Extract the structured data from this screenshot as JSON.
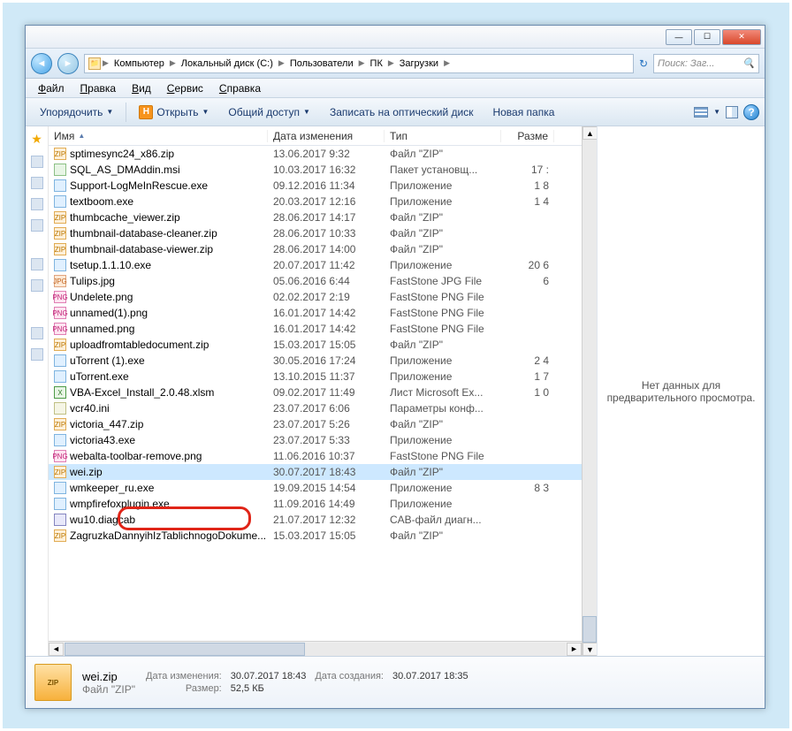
{
  "window_controls": {
    "minimize": "—",
    "maximize": "☐",
    "close": "✕"
  },
  "nav": {
    "back": "◄",
    "forward": "►"
  },
  "breadcrumbs": [
    "Компьютер",
    "Локальный диск (C:)",
    "Пользователи",
    "ПК",
    "Загрузки"
  ],
  "search": {
    "placeholder": "Поиск: Заг..."
  },
  "menus": [
    {
      "label": "Файл",
      "u": "Ф"
    },
    {
      "label": "Правка",
      "u": "П"
    },
    {
      "label": "Вид",
      "u": "В"
    },
    {
      "label": "Сервис",
      "u": "С"
    },
    {
      "label": "Справка",
      "u": "С"
    }
  ],
  "toolbar": {
    "organize": "Упорядочить",
    "open": "Открыть",
    "open_hotkey": "H",
    "share": "Общий доступ",
    "burn": "Записать на оптический диск",
    "newfolder": "Новая папка"
  },
  "columns": {
    "name": "Имя",
    "date": "Дата изменения",
    "type": "Тип",
    "size": "Разме"
  },
  "preview_empty": "Нет данных для предварительного просмотра.",
  "files": [
    {
      "ico": "zip",
      "name": "sptimesync24_x86.zip",
      "date": "13.06.2017 9:32",
      "type": "Файл \"ZIP\"",
      "size": ""
    },
    {
      "ico": "msi",
      "name": "SQL_AS_DMAddin.msi",
      "date": "10.03.2017 16:32",
      "type": "Пакет установщ...",
      "size": "17 :"
    },
    {
      "ico": "exe",
      "name": "Support-LogMeInRescue.exe",
      "date": "09.12.2016 11:34",
      "type": "Приложение",
      "size": "1 8"
    },
    {
      "ico": "exe",
      "name": "textboom.exe",
      "date": "20.03.2017 12:16",
      "type": "Приложение",
      "size": "1 4"
    },
    {
      "ico": "zip",
      "name": "thumbcache_viewer.zip",
      "date": "28.06.2017 14:17",
      "type": "Файл \"ZIP\"",
      "size": ""
    },
    {
      "ico": "zip",
      "name": "thumbnail-database-cleaner.zip",
      "date": "28.06.2017 10:33",
      "type": "Файл \"ZIP\"",
      "size": ""
    },
    {
      "ico": "zip",
      "name": "thumbnail-database-viewer.zip",
      "date": "28.06.2017 14:00",
      "type": "Файл \"ZIP\"",
      "size": ""
    },
    {
      "ico": "exe",
      "name": "tsetup.1.1.10.exe",
      "date": "20.07.2017 11:42",
      "type": "Приложение",
      "size": "20 6"
    },
    {
      "ico": "jpg",
      "name": "Tulips.jpg",
      "date": "05.06.2016 6:44",
      "type": "FastStone JPG File",
      "size": "6"
    },
    {
      "ico": "png",
      "name": "Undelete.png",
      "date": "02.02.2017 2:19",
      "type": "FastStone PNG File",
      "size": ""
    },
    {
      "ico": "png",
      "name": "unnamed(1).png",
      "date": "16.01.2017 14:42",
      "type": "FastStone PNG File",
      "size": ""
    },
    {
      "ico": "png",
      "name": "unnamed.png",
      "date": "16.01.2017 14:42",
      "type": "FastStone PNG File",
      "size": ""
    },
    {
      "ico": "zip",
      "name": "uploadfromtabledocument.zip",
      "date": "15.03.2017 15:05",
      "type": "Файл \"ZIP\"",
      "size": ""
    },
    {
      "ico": "exe",
      "name": "uTorrent (1).exe",
      "date": "30.05.2016 17:24",
      "type": "Приложение",
      "size": "2 4"
    },
    {
      "ico": "exe",
      "name": "uTorrent.exe",
      "date": "13.10.2015 11:37",
      "type": "Приложение",
      "size": "1 7"
    },
    {
      "ico": "xls",
      "name": "VBA-Excel_Install_2.0.48.xlsm",
      "date": "09.02.2017 11:49",
      "type": "Лист Microsoft Ex...",
      "size": "1 0"
    },
    {
      "ico": "ini",
      "name": "vcr40.ini",
      "date": "23.07.2017 6:06",
      "type": "Параметры конф...",
      "size": ""
    },
    {
      "ico": "zip",
      "name": "victoria_447.zip",
      "date": "23.07.2017 5:26",
      "type": "Файл \"ZIP\"",
      "size": ""
    },
    {
      "ico": "exe",
      "name": "victoria43.exe",
      "date": "23.07.2017 5:33",
      "type": "Приложение",
      "size": ""
    },
    {
      "ico": "png",
      "name": "webalta-toolbar-remove.png",
      "date": "11.06.2016 10:37",
      "type": "FastStone PNG File",
      "size": ""
    },
    {
      "ico": "zip",
      "name": "wei.zip",
      "date": "30.07.2017 18:43",
      "type": "Файл \"ZIP\"",
      "size": "",
      "selected": true
    },
    {
      "ico": "exe",
      "name": "wmkeeper_ru.exe",
      "date": "19.09.2015 14:54",
      "type": "Приложение",
      "size": "8 3"
    },
    {
      "ico": "exe",
      "name": "wmpfirefoxplugin.exe",
      "date": "11.09.2016 14:49",
      "type": "Приложение",
      "size": ""
    },
    {
      "ico": "cab",
      "name": "wu10.diagcab",
      "date": "21.07.2017 12:32",
      "type": "CAB-файл диагн...",
      "size": ""
    },
    {
      "ico": "zip",
      "name": "ZagruzkaDannyihIzTablichnogoDokume...",
      "date": "15.03.2017 15:05",
      "type": "Файл \"ZIP\"",
      "size": ""
    }
  ],
  "details": {
    "name": "wei.zip",
    "type": "Файл \"ZIP\"",
    "lbl_modified": "Дата изменения:",
    "modified": "30.07.2017 18:43",
    "lbl_size": "Размер:",
    "size": "52,5 КБ",
    "lbl_created": "Дата создания:",
    "created": "30.07.2017 18:35"
  }
}
